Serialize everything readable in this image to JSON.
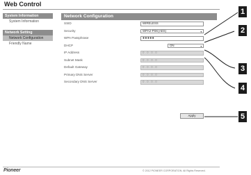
{
  "app": {
    "title": "Web Control"
  },
  "sidebar": {
    "sections": [
      {
        "heading": "System Information",
        "items": [
          {
            "label": "System Information",
            "active": false
          }
        ]
      },
      {
        "heading": "Network Setting",
        "items": [
          {
            "label": "Network Configuration",
            "active": true
          },
          {
            "label": "Friendly Name",
            "active": false
          }
        ]
      }
    ]
  },
  "panel": {
    "title": "Network Configuration",
    "fields": {
      "ssid": {
        "label": "SSID",
        "value": "WIRELESS"
      },
      "security": {
        "label": "Security",
        "value": "WPA2-PSK(AES)"
      },
      "passphrase": {
        "label": "WPA Passphrase",
        "value": "●●●●●"
      },
      "dhcp": {
        "label": "DHCP",
        "value": "ON"
      },
      "ip": {
        "label": "IP Address",
        "value": "0 . 0 . 0 . 0"
      },
      "mask": {
        "label": "Subnet Mask",
        "value": "0 . 0 . 0 . 0"
      },
      "gateway": {
        "label": "Default Gateway",
        "value": "0 . 0 . 0 . 0"
      },
      "dns1": {
        "label": "Primary DNS Server",
        "value": "0 . 0 . 0 . 0"
      },
      "dns2": {
        "label": "Secondary DNS Server",
        "value": "0 . 0 . 0 . 0"
      }
    },
    "apply_label": "Apply"
  },
  "footer": {
    "brand": "Pioneer",
    "copyright": "© 2012 PIONEER CORPORATION. All Rights Reserved."
  },
  "callouts": [
    "1",
    "2",
    "3",
    "4",
    "5"
  ]
}
